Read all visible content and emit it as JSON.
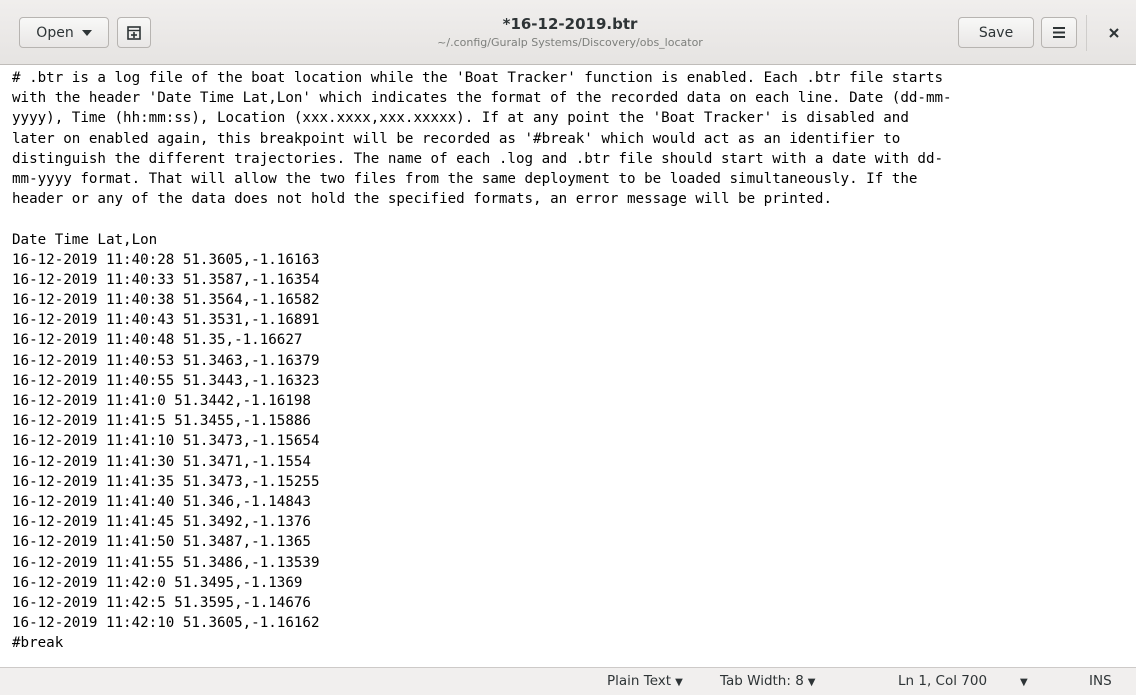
{
  "header": {
    "open_label": "Open",
    "title": "*16-12-2019.btr",
    "subtitle": "~/.config/Guralp Systems/Discovery/obs_locator",
    "save_label": "Save",
    "icons": [
      "chevron-down-icon",
      "new-tab-icon",
      "hamburger-menu-icon",
      "close-icon"
    ]
  },
  "document": {
    "lines": [
      "# .btr is a log file of the boat location while the 'Boat Tracker' function is enabled. Each .btr file starts",
      "with the header 'Date Time Lat,Lon' which indicates the format of the recorded data on each line. Date (dd-mm-",
      "yyyy), Time (hh:mm:ss), Location (xxx.xxxx,xxx.xxxxx). If at any point the 'Boat Tracker' is disabled and",
      "later on enabled again, this breakpoint will be recorded as '#break' which would act as an identifier to",
      "distinguish the different trajectories. The name of each .log and .btr file should start with a date with dd-",
      "mm-yyyy format. That will allow the two files from the same deployment to be loaded simultaneously. If the",
      "header or any of the data does not hold the specified formats, an error message will be printed.",
      "",
      "Date Time Lat,Lon",
      "16-12-2019 11:40:28 51.3605,-1.16163",
      "16-12-2019 11:40:33 51.3587,-1.16354",
      "16-12-2019 11:40:38 51.3564,-1.16582",
      "16-12-2019 11:40:43 51.3531,-1.16891",
      "16-12-2019 11:40:48 51.35,-1.16627",
      "16-12-2019 11:40:53 51.3463,-1.16379",
      "16-12-2019 11:40:55 51.3443,-1.16323",
      "16-12-2019 11:41:0 51.3442,-1.16198",
      "16-12-2019 11:41:5 51.3455,-1.15886",
      "16-12-2019 11:41:10 51.3473,-1.15654",
      "16-12-2019 11:41:30 51.3471,-1.1554",
      "16-12-2019 11:41:35 51.3473,-1.15255",
      "16-12-2019 11:41:40 51.346,-1.14843",
      "16-12-2019 11:41:45 51.3492,-1.1376",
      "16-12-2019 11:41:50 51.3487,-1.1365",
      "16-12-2019 11:41:55 51.3486,-1.13539",
      "16-12-2019 11:42:0 51.3495,-1.1369",
      "16-12-2019 11:42:5 51.3595,-1.14676",
      "16-12-2019 11:42:10 51.3605,-1.16162",
      "#break"
    ]
  },
  "statusbar": {
    "language": "Plain Text",
    "tab_width": "Tab Width: 8",
    "position": "Ln 1, Col 700",
    "mode": "INS"
  }
}
